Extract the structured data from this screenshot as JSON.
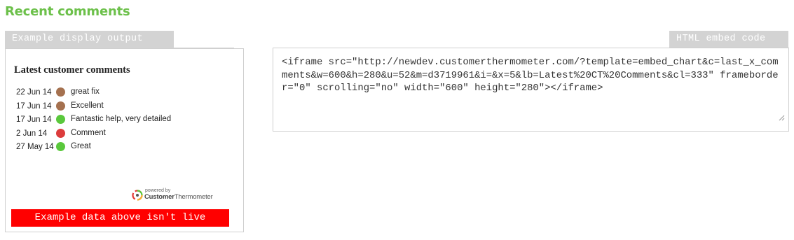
{
  "section": {
    "title": "Recent comments"
  },
  "preview": {
    "tab_label": "Example display output",
    "widget_title": "Latest customer comments",
    "comments": [
      {
        "date": "22 Jun 14",
        "text": "great fix",
        "color": "#a5714f"
      },
      {
        "date": "17 Jun 14",
        "text": "Excellent",
        "color": "#a5714f"
      },
      {
        "date": "17 Jun 14",
        "text": "Fantastic help, very detailed",
        "color": "#5ac83c"
      },
      {
        "date": "2 Jun 14",
        "text": "Comment",
        "color": "#dc3c3c"
      },
      {
        "date": "27 May 14",
        "text": "Great",
        "color": "#5ac83c"
      }
    ],
    "powered_by_small": "powered by",
    "powered_by_brand_bold": "Customer",
    "powered_by_brand_rest": "Thermometer",
    "powered_icon": "customer-thermometer-logo-icon",
    "live_warning": "Example data above isn't live"
  },
  "embed": {
    "tab_label": "HTML embed code",
    "code": "<iframe src=\"http://newdev.customerthermometer.com/?template=embed_chart&c=last_x_comments&w=600&h=280&u=52&m=d3719961&i=&x=5&lb=Latest%20CT%20Comments&cl=333\" frameborder=\"0\" scrolling=\"no\" width=\"600\" height=\"280\"></iframe>"
  },
  "colors": {
    "accent_green": "#6cc04a",
    "tab_gray": "#d3d3d3",
    "warning_red": "#ff0000"
  }
}
